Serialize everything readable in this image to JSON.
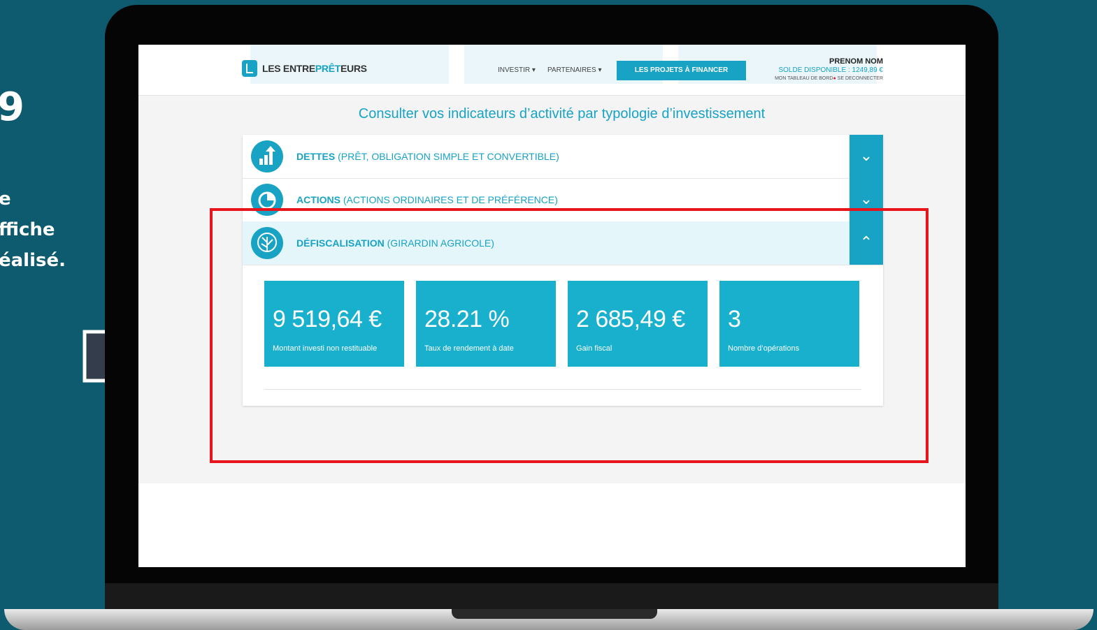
{
  "side_text": {
    "number": "9",
    "lines": [
      "e",
      "ffiche",
      "éalisé."
    ]
  },
  "header": {
    "logo_prefix": "LES ENTRE",
    "logo_accent": "PRÊT",
    "logo_suffix": "EURS",
    "nav": [
      {
        "label": "INVESTIR"
      },
      {
        "label": "PARTENAIRES"
      }
    ],
    "cta_label": "LES PROJETS À FINANCER",
    "user_name": "PRENOM NOM",
    "balance": "SOLDE DISPONIBLE : 1249,89 €",
    "dashboard_link": "MON TABLEAU DE BORD",
    "logout_link": "SE DECONNECTER"
  },
  "page_title": "Consulter vos indicateurs d’activité par typologie d’investissement",
  "categories": [
    {
      "title": "DETTES",
      "subtitle": " (PRÊT, OBLIGATION SIMPLE ET CONVERTIBLE)",
      "toggle": "⌄"
    },
    {
      "title": "ACTIONS",
      "subtitle": " (ACTIONS ORDINAIRES ET DE PRÉFÉRENCE)",
      "toggle": "⌄"
    },
    {
      "title": "DÉFISCALISATION",
      "subtitle": " (GIRARDIN AGRICOLE)",
      "toggle": "⌃"
    }
  ],
  "kpis": [
    {
      "value": "9 519,64 €",
      "label": "Montant investi non restituable"
    },
    {
      "value": "28.21 %",
      "label": "Taux de rendement à date"
    },
    {
      "value": "2 685,49 €",
      "label": "Gain fiscal"
    },
    {
      "value": "3",
      "label": "Nombre d’opérations"
    }
  ],
  "colors": {
    "brand": "#18a3c4",
    "kpi_tile": "#18b0cd",
    "background": "#0e5a6e",
    "highlight": "#e8141c"
  },
  "icons": {
    "row_1": "growth-chart-icon",
    "row_2": "pie-chart-icon",
    "row_3": "tree-icon"
  }
}
